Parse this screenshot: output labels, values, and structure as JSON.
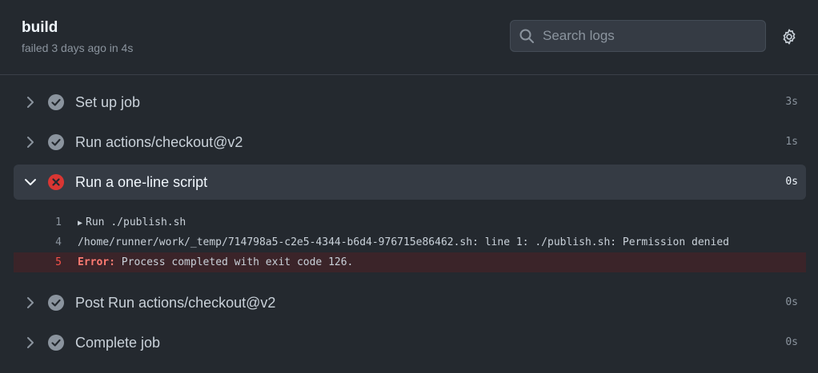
{
  "header": {
    "job_title": "build",
    "job_meta": "failed 3 days ago in 4s",
    "search_placeholder": "Search logs"
  },
  "icons": {
    "search": "search-icon",
    "settings": "gear-icon",
    "collapsed": "chevron-right-icon",
    "expanded": "chevron-down-icon",
    "success": "check-circle-icon",
    "failure": "x-circle-icon",
    "disclosure": "triangle-right-icon"
  },
  "colors": {
    "background": "#24292f",
    "active_row": "#353b44",
    "success_icon": "#8b949e",
    "failure_icon": "#da3633",
    "error_row": "#3b2429",
    "error_text": "#ff7b72"
  },
  "steps": [
    {
      "name": "Set up job",
      "duration": "3s",
      "status": "success",
      "expanded": false
    },
    {
      "name": "Run actions/checkout@v2",
      "duration": "1s",
      "status": "success",
      "expanded": false
    },
    {
      "name": "Run a one-line script",
      "duration": "0s",
      "status": "failure",
      "expanded": true
    },
    {
      "name": "Post Run actions/checkout@v2",
      "duration": "0s",
      "status": "success",
      "expanded": false
    },
    {
      "name": "Complete job",
      "duration": "0s",
      "status": "success",
      "expanded": false
    }
  ],
  "log": [
    {
      "line": "1",
      "text": "Run ./publish.sh"
    },
    {
      "line": "4",
      "text": "/home/runner/work/_temp/714798a5-c2e5-4344-b6d4-976715e86462.sh: line 1: ./publish.sh: Permission denied"
    },
    {
      "line": "5",
      "label": "Error:",
      "text": " Process completed with exit code 126."
    }
  ]
}
